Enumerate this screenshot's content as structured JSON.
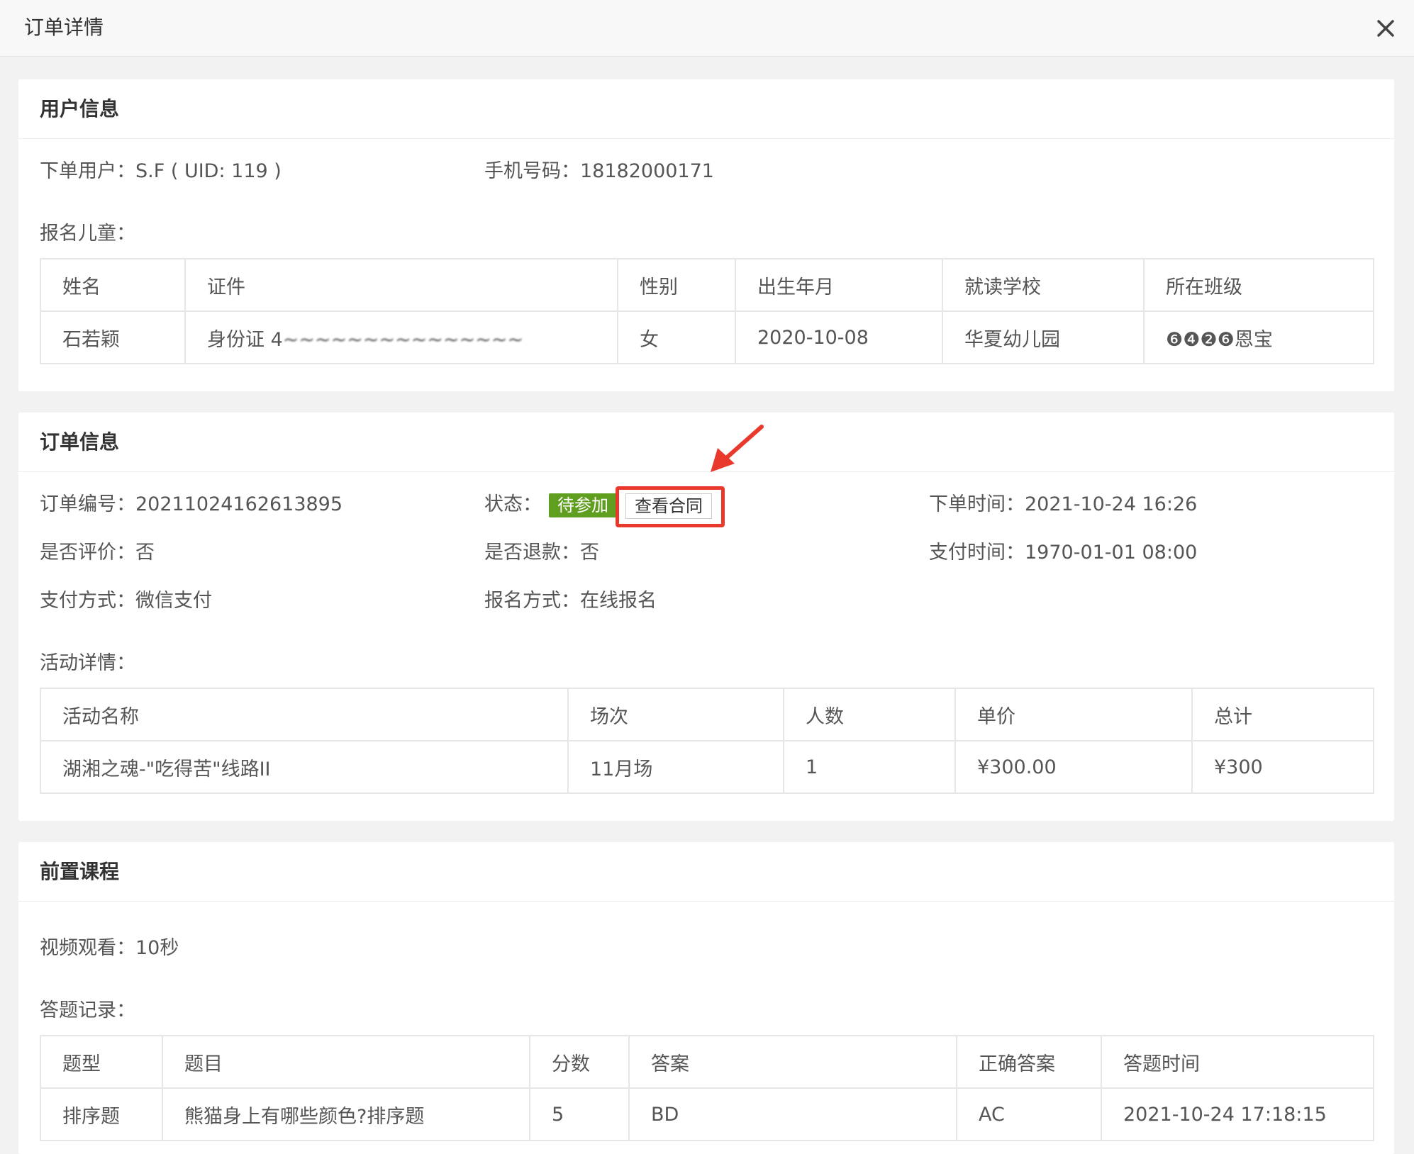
{
  "window": {
    "title": "订单详情"
  },
  "user_section": {
    "heading": "用户信息",
    "order_user_label": "下单用户：",
    "order_user_value": "S.F ( UID: 119 )",
    "phone_label": "手机号码：",
    "phone_value": "18182000171",
    "children_label": "报名儿童：",
    "table_headers": [
      "姓名",
      "证件",
      "性别",
      "出生年月",
      "就读学校",
      "所在班级"
    ],
    "rows": [
      [
        "石若颖",
        "身份证 4",
        "女",
        "2020-10-08",
        "华夏幼儿园",
        "❻❹❷❻恩宝"
      ]
    ]
  },
  "order_section": {
    "heading": "订单信息",
    "order_no_label": "订单编号：",
    "order_no_value": "20211024162613895",
    "status_label": "状态：",
    "status_badge": "待参加",
    "contract_button": "查看合同",
    "order_time_label": "下单时间：",
    "order_time_value": "2021-10-24 16:26",
    "reviewed_label": "是否评价：",
    "reviewed_value": "否",
    "refunded_label": "是否退款：",
    "refunded_value": "否",
    "pay_time_label": "支付时间：",
    "pay_time_value": "1970-01-01 08:00",
    "pay_method_label": "支付方式：",
    "pay_method_value": "微信支付",
    "signup_method_label": "报名方式：",
    "signup_method_value": "在线报名",
    "activity_label": "活动详情：",
    "table_headers": [
      "活动名称",
      "场次",
      "人数",
      "单价",
      "总计"
    ],
    "rows": [
      [
        "湖湘之魂-\"吃得苦\"线路II",
        "11月场",
        "1",
        "¥300.00",
        "¥300"
      ]
    ]
  },
  "course_section": {
    "heading": "前置课程",
    "video_label": "视频观看：",
    "video_value": "10秒",
    "answers_label": "答题记录：",
    "table_headers": [
      "题型",
      "题目",
      "分数",
      "答案",
      "正确答案",
      "答题时间"
    ],
    "rows": [
      [
        "排序题",
        "熊猫身上有哪些颜色?排序题",
        "5",
        "BD",
        "AC",
        "2021-10-24 17:18:15"
      ]
    ]
  },
  "colors": {
    "badge_green": "#5f9e1f",
    "highlight_red": "#e8392c",
    "background": "#f2f2f2"
  },
  "icons": {
    "close": "close-icon",
    "annotation": "red-arrow-icon"
  }
}
